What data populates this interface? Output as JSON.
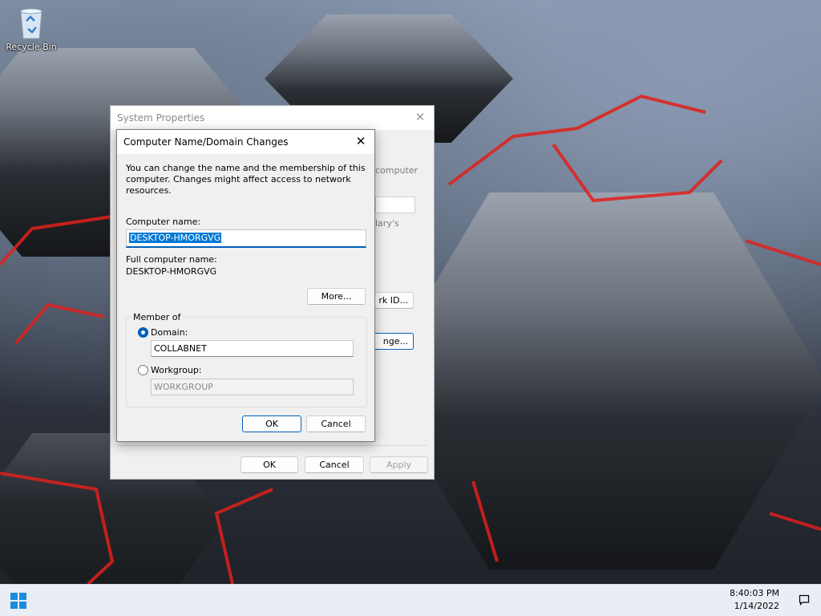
{
  "desktop": {
    "icons": [
      {
        "label": "Recycle Bin",
        "icon": "recycle-bin-icon"
      }
    ]
  },
  "system_properties": {
    "title": "System Properties",
    "fragments": {
      "computer": "computer",
      "library": "lary's",
      "network_id": "rk ID...",
      "change": "nge..."
    },
    "buttons": {
      "ok": "OK",
      "cancel": "Cancel",
      "apply": "Apply"
    }
  },
  "dialog": {
    "title": "Computer Name/Domain Changes",
    "description": "You can change the name and the membership of this computer. Changes might affect access to network resources.",
    "computer_name_label": "Computer name:",
    "computer_name_value": "DESKTOP-HMORGVG",
    "full_name_label": "Full computer name:",
    "full_name_value": "DESKTOP-HMORGVG",
    "more_button": "More...",
    "member_of": {
      "label": "Member of",
      "domain_label": "Domain:",
      "domain_value": "COLLABNET",
      "domain_selected": true,
      "workgroup_label": "Workgroup:",
      "workgroup_value": "WORKGROUP",
      "workgroup_selected": false
    },
    "ok_button": "OK",
    "cancel_button": "Cancel"
  },
  "taskbar": {
    "time": "8:40:03 PM",
    "date": "1/14/2022"
  },
  "colors": {
    "accent": "#005fb8",
    "selection": "#0078d4"
  }
}
